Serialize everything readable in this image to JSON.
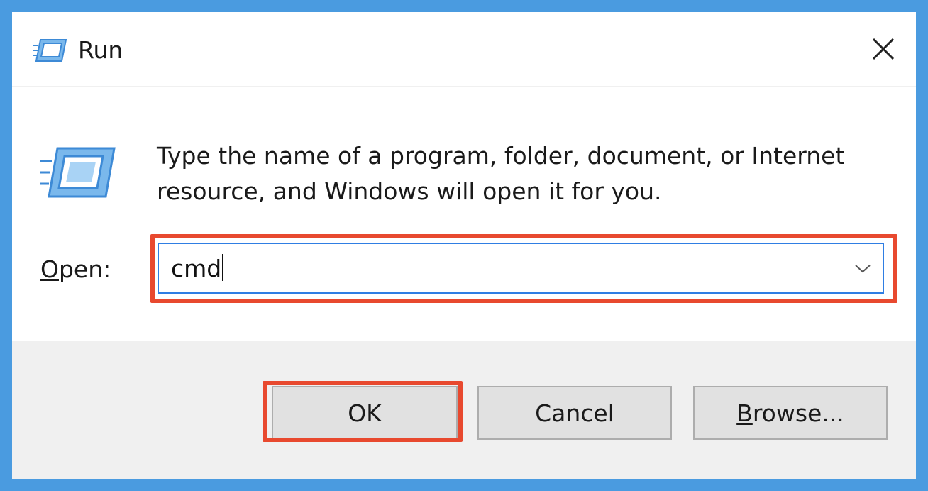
{
  "window": {
    "title": "Run",
    "accent_color": "#4a9be0",
    "title_icon": "run-app-icon",
    "close_icon": "close-icon"
  },
  "content": {
    "icon": "run-app-icon",
    "description": "Type the name of a program, folder, document, or Internet resource, and Windows will open it for you.",
    "open_label_underlined": "O",
    "open_label_rest": "pen:",
    "input_value": "cmd",
    "dropdown_icon": "chevron-down-icon"
  },
  "buttons": {
    "ok": "OK",
    "cancel": "Cancel",
    "browse_underlined": "B",
    "browse_rest": "rowse..."
  },
  "highlight_color": "#e8492f"
}
